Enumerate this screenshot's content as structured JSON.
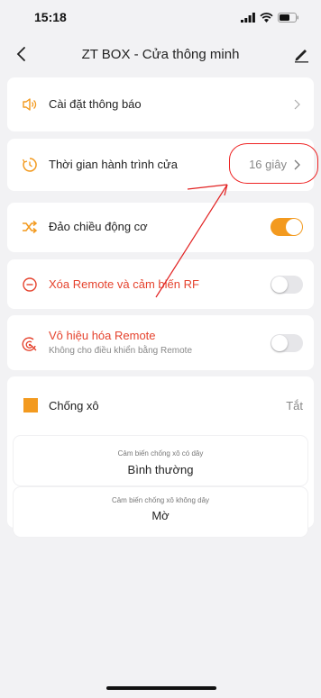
{
  "status": {
    "time": "15:18"
  },
  "nav": {
    "title": "ZT BOX - Cửa thông minh"
  },
  "rows": {
    "notify": {
      "label": "Cài đặt thông báo"
    },
    "travel_time": {
      "label": "Thời gian hành trình cửa",
      "value": "16 giây"
    },
    "reverse_motor": {
      "label": "Đảo chiều động cơ",
      "on": true
    },
    "delete_remote": {
      "label": "Xóa Remote và cảm biến RF",
      "on": false
    },
    "disable_remote": {
      "label": "Vô hiệu hóa Remote",
      "sub": "Không cho điều khiển bằng Remote",
      "on": false
    },
    "anti_pinch": {
      "label": "Chống xô",
      "value": "Tắt"
    }
  },
  "sensors": {
    "wired": {
      "title": "Cảm biến chống xô có dây",
      "value": "Bình thường"
    },
    "wireless": {
      "title": "Cảm biến chống xô không dây",
      "value": "Mờ"
    }
  },
  "colors": {
    "accent": "#f39a1f",
    "danger": "#e5432e",
    "annotation": "#e22222"
  }
}
